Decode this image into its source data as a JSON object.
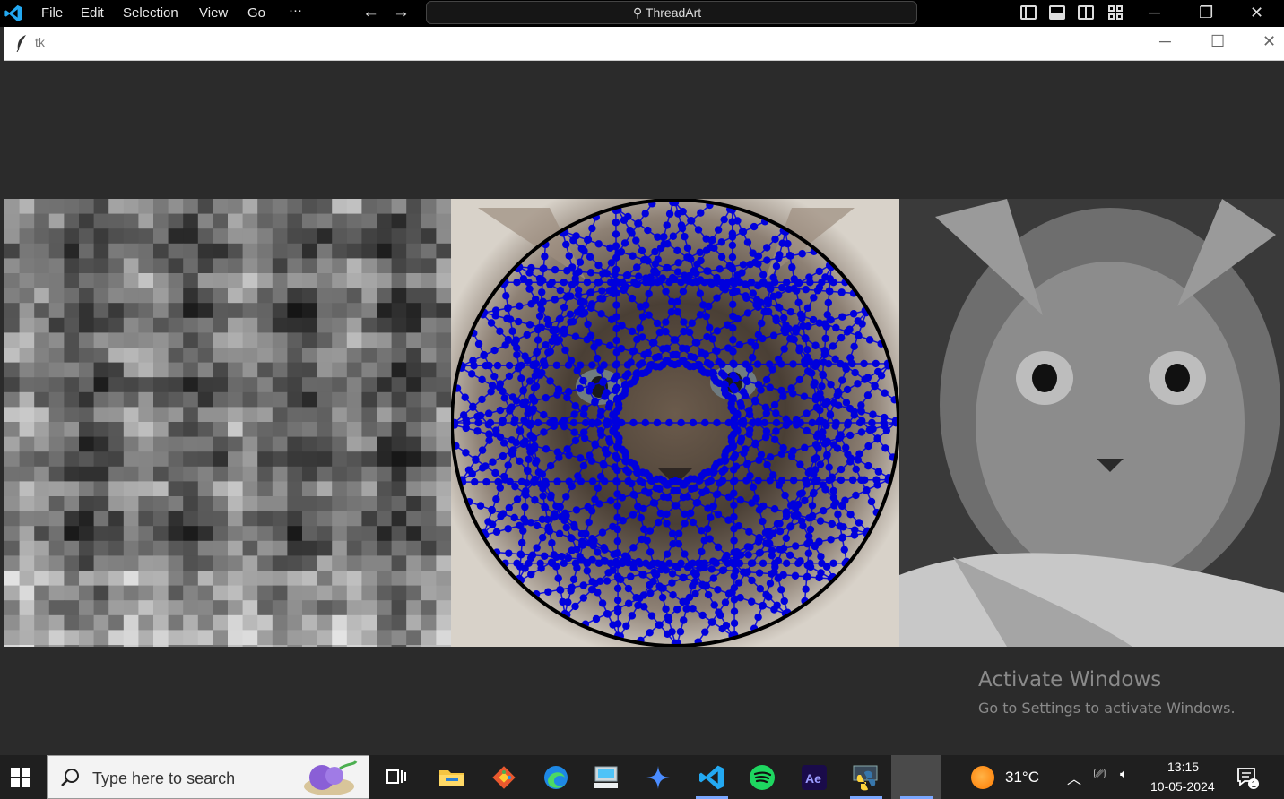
{
  "vscode": {
    "menu": [
      "File",
      "Edit",
      "Selection",
      "View",
      "Go",
      "···"
    ],
    "search_label": "ThreadArt"
  },
  "tk": {
    "title": "tk"
  },
  "overlay": {
    "activate_title": "Activate Windows",
    "activate_sub": "Go to Settings to activate Windows."
  },
  "taskbar": {
    "search_placeholder": "Type here to search",
    "apps": [
      "task-view",
      "file-explorer",
      "git",
      "edge",
      "keyboard-app",
      "copilot",
      "vscode",
      "spotify",
      "after-effects",
      "python",
      "tk-window"
    ],
    "weather_temp": "31°C",
    "time": "13:15",
    "date": "10-05-2024",
    "notification_count": "1"
  },
  "colors": {
    "thread_dot": "#0000dd",
    "accent": "#0078d4"
  }
}
